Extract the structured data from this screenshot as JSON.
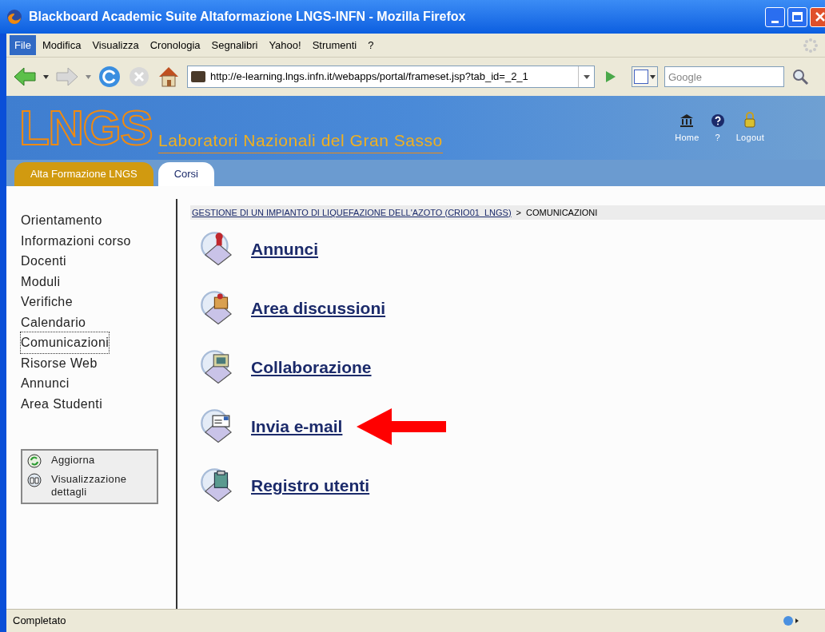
{
  "window": {
    "title": "Blackboard Academic Suite Altaformazione LNGS-INFN - Mozilla Firefox"
  },
  "menu": [
    {
      "label": "File",
      "selected": true
    },
    {
      "label": "Modifica",
      "selected": false
    },
    {
      "label": "Visualizza",
      "selected": false
    },
    {
      "label": "Cronologia",
      "selected": false
    },
    {
      "label": "Segnalibri",
      "selected": false
    },
    {
      "label": "Yahoo!",
      "selected": false
    },
    {
      "label": "Strumenti",
      "selected": false
    },
    {
      "label": "?",
      "selected": false
    }
  ],
  "toolbar": {
    "url": "http://e-learning.lngs.infn.it/webapps/portal/frameset.jsp?tab_id=_2_1",
    "search_placeholder": "Google"
  },
  "banner": {
    "logo": "LNGS",
    "subtitle": "Laboratori Nazionali del Gran Sasso",
    "links": [
      {
        "kind": "home",
        "label": "Home"
      },
      {
        "kind": "help",
        "label": "?"
      },
      {
        "kind": "logout",
        "label": "Logout"
      }
    ]
  },
  "tabs": [
    {
      "label": "Alta Formazione LNGS",
      "selected": false
    },
    {
      "label": "Corsi",
      "selected": true
    }
  ],
  "sidebar": {
    "items": [
      {
        "label": "Orientamento",
        "focused": false
      },
      {
        "label": "Informazioni corso",
        "focused": false
      },
      {
        "label": "Docenti",
        "focused": false
      },
      {
        "label": "Moduli",
        "focused": false
      },
      {
        "label": "Verifiche",
        "focused": false
      },
      {
        "label": "Calendario",
        "focused": false
      },
      {
        "label": "Comunicazioni",
        "focused": true
      },
      {
        "label": "Risorse Web",
        "focused": false
      },
      {
        "label": "Annunci",
        "focused": false
      },
      {
        "label": "Area Studenti",
        "focused": false
      }
    ],
    "actions": [
      {
        "kind": "refresh",
        "label": "Aggiorna"
      },
      {
        "kind": "details",
        "label": "Visualizzazione dettagli"
      }
    ]
  },
  "breadcrumb": {
    "link": "GESTIONE DI UN IMPIANTO DI LIQUEFAZIONE DELL'AZOTO (CRIO01_LNGS)",
    "separator": ">",
    "current": "COMUNICAZIONI"
  },
  "tools": [
    {
      "kind": "announcements",
      "label": "Annunci",
      "pointed": false
    },
    {
      "kind": "discussions",
      "label": "Area discussioni",
      "pointed": false
    },
    {
      "kind": "collaboration",
      "label": "Collaborazione",
      "pointed": false
    },
    {
      "kind": "email",
      "label": "Invia e-mail",
      "pointed": true
    },
    {
      "kind": "roster",
      "label": "Registro utenti",
      "pointed": false
    }
  ],
  "status_bar": {
    "text": "Completato"
  }
}
